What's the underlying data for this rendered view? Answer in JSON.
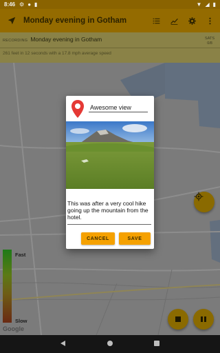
{
  "status_bar": {
    "time": "8:46"
  },
  "app_bar": {
    "title": "Monday evening in Gotham"
  },
  "recording": {
    "label": "RECORDING",
    "name": "Monday evening in Gotham",
    "sats_label": "SATS",
    "sats_value": "0/8",
    "stats": "261 feet in 12 seconds with a 17.8 mph average speed"
  },
  "map": {
    "speed_fast": "Fast",
    "speed_slow": "Slow",
    "attribution": "Google"
  },
  "dialog": {
    "marker_name": "Awesome view",
    "description": "This was after a very cool hike going up the mountain from the hotel.",
    "cancel_label": "CANCEL",
    "save_label": "SAVE"
  },
  "colors": {
    "primary": "#946b00",
    "accent": "#f5a100",
    "marker": "#e53935"
  },
  "icons": {
    "nav": "navigation-arrow-icon",
    "list": "list-icon",
    "chart": "chart-icon",
    "settings": "gear-icon",
    "more": "more-vert-icon"
  }
}
